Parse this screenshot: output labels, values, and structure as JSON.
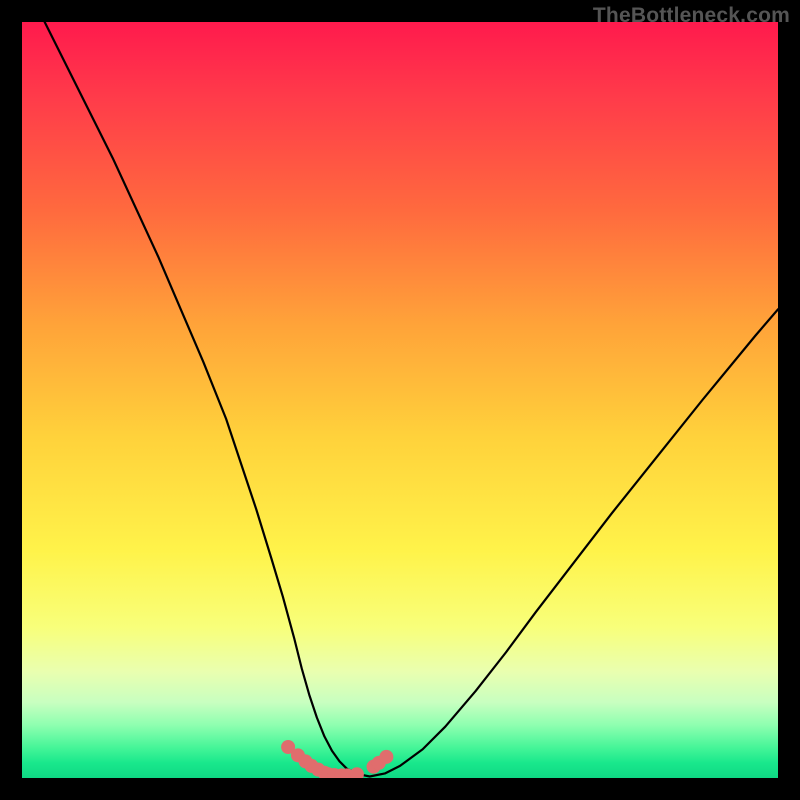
{
  "watermark": "TheBottleneck.com",
  "chart_data": {
    "type": "line",
    "title": "",
    "xlabel": "",
    "ylabel": "",
    "xlim": [
      0,
      100
    ],
    "ylim": [
      0,
      100
    ],
    "series": [
      {
        "name": "bottleneck-curve",
        "x": [
          3,
          6,
          9,
          12,
          15,
          18,
          21,
          24,
          27,
          29,
          31,
          33,
          34.5,
          36,
          37,
          38,
          39,
          40,
          41,
          42,
          43,
          44.5,
          46,
          48,
          50,
          53,
          56,
          60,
          64,
          68,
          73,
          78,
          84,
          90,
          97,
          100
        ],
        "y": [
          100,
          94,
          88,
          82,
          75.5,
          69,
          62,
          55,
          47.5,
          41.5,
          35.5,
          29,
          24,
          18.5,
          14.5,
          11,
          8,
          5.5,
          3.6,
          2.2,
          1.2,
          0.5,
          0.2,
          0.6,
          1.6,
          3.8,
          6.8,
          11.5,
          16.6,
          22,
          28.5,
          35,
          42.5,
          50,
          58.5,
          62
        ]
      }
    ],
    "scatter_series": [
      {
        "name": "minimum-markers",
        "color": "#e06d6d",
        "radius_px": 7,
        "x": [
          35.2,
          36.5,
          37.5,
          38.3,
          39.2,
          40.0,
          40.5,
          41.3,
          42.3,
          43.0,
          44.3,
          46.5,
          47.2,
          48.2
        ],
        "y": [
          4.1,
          3.0,
          2.2,
          1.6,
          1.1,
          0.7,
          0.5,
          0.4,
          0.35,
          0.35,
          0.5,
          1.5,
          2.0,
          2.8
        ]
      }
    ]
  }
}
